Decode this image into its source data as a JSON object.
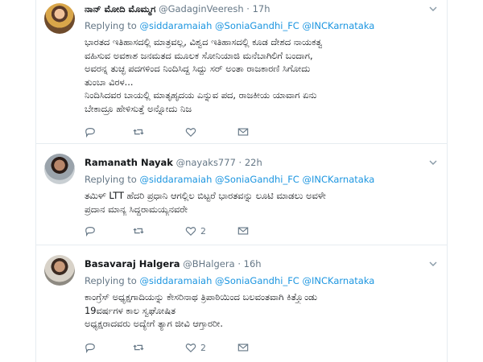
{
  "tweets": [
    {
      "name": "ನಾನ್ ಮೋದಿ ಮೊಮ್ಮಗ",
      "handle": "@GadaginVeeresh",
      "time": "17h",
      "replying_to_label": "Replying to",
      "mentions": [
        "@siddaramaiah",
        "@SoniaGandhi_FC",
        "@INCKarnataka"
      ],
      "lines": [
        "ಭಾರತದ ಇತಿಹಾಸದಲ್ಲಿ ಮಾತ್ರವಲ್ಲ, ವಿಶ್ವದ ಇತಿಹಾಸದಲ್ಲಿ ಕೂಡ ದೇಶದ ನಾಯಕತ್ವ",
        "ವಹಿಸುವ ಅವಕಾಶ ಜನಮತದ ಮೂಲಕ ಸೋನಿಯಾಜಿ ಮನೆಬಾಗಿಲಿಗೆ ಬಂದಾಗ,",
        "ಅವರನ್ನ ತುಚ್ಛ ಪದಗಳಿಂದ ನಿಂದಿಸಿದ್ದ ಸಿದ್ದು ಸರ್ ಅಂತಾ ರಾಜಕಾರಣಿ ಸಿಗೋದು",
        "ತುಂಬಾ ವಿರಳ...",
        "ನಿಂದಿಸಿದವರ ಬಾಯಲ್ಲಿ ಮಾತೃಹೃದಯ ಎನ್ನುವ ಪದ, ರಾಜಕೀಯ ಯಾವಾಗ ಏನು",
        "ಬೇಕಾದ್ರೂ ಹೇಳಿಸುತ್ತೆ ಅನ್ನೋದು ನಿಜ"
      ],
      "likes": ""
    },
    {
      "name": "Ramanath Nayak",
      "handle": "@nayaks777",
      "time": "22h",
      "replying_to_label": "Replying to",
      "mentions": [
        "@siddaramaiah",
        "@SoniaGandhi_FC",
        "@INCKarnataka"
      ],
      "lines": [
        "ತಮಿಳ್ LTT ಹೆದರಿ ಪ್ರಧಾನಿ ಆಗಲ್ಲಿಲ ಬಿಟ್ಟರೆ ಭಾರತವನ್ನು ಲೂಟಿ ಮಾಡಲು ಅವಳೇ",
        "ಪ್ರದಾನ ಮಾನ್ಯ ಸಿದ್ದರಾಮಯ್ಯನವರೇ"
      ],
      "likes": "2"
    },
    {
      "name": "Basavaraj Halgera",
      "handle": "@BHalgera",
      "time": "16h",
      "replying_to_label": "Replying to",
      "mentions": [
        "@siddaramaiah",
        "@SoniaGandhi_FC",
        "@INCKarnataka"
      ],
      "lines": [
        "ಕಾಂಗ್ರೆಸ್ ಅಧ್ಯಕ್ಷಗಾದಿಯನ್ನು ಕೇಸರಿನಾಥ ತ್ರಿಪಾಠಿಯಿಂದ ಬಲವಂತವಾಗಿ ಕಿತ್ತ್ಕೊಂಡು",
        "19ವರ್ಷಗಳ ಕಾಲ ಸ್ವಘೋಷಿತ",
        "ಅಧ್ಯಕ್ಷರಾದವರು ಅದ್ಯೇಗೆ ತ್ಯಾಗ ಜೀವಿ ಆಗ್ತಾರರೀ."
      ],
      "likes": "2"
    }
  ]
}
